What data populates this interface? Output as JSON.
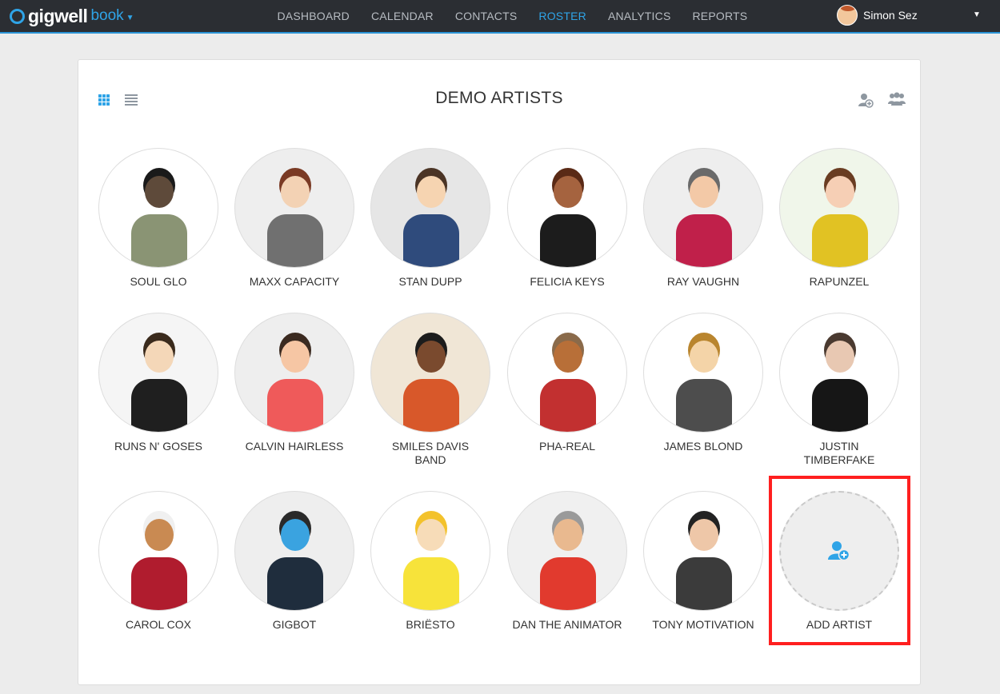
{
  "app": {
    "logo_text": "gigwell",
    "product": "book",
    "nav": [
      "DASHBOARD",
      "CALENDAR",
      "CONTACTS",
      "ROSTER",
      "ANALYTICS",
      "REPORTS"
    ],
    "active_nav": "ROSTER",
    "user_name": "Simon Sez"
  },
  "roster": {
    "title": "DEMO ARTISTS",
    "view_modes": [
      "grid-icon",
      "list-icon"
    ],
    "active_view": "grid",
    "header_actions": [
      "add-artist-icon",
      "add-band-icon"
    ],
    "artists": [
      {
        "name": "SOUL GLO",
        "skin": "#5e4a3a",
        "hair": "#1a1a1a",
        "shirt": "#8a9474",
        "bg": "#ffffff"
      },
      {
        "name": "MAXX CAPACITY",
        "skin": "#f3d2b4",
        "hair": "#7a3a24",
        "shirt": "#707070",
        "bg": "#eeeeee"
      },
      {
        "name": "STAN DUPP",
        "skin": "#f6d4b1",
        "hair": "#4b3425",
        "shirt": "#2f4b7c",
        "bg": "#e6e6e6"
      },
      {
        "name": "FELICIA KEYS",
        "skin": "#a5633f",
        "hair": "#5a2a16",
        "shirt": "#1c1c1c",
        "bg": "#ffffff"
      },
      {
        "name": "RAY VAUGHN",
        "skin": "#f3c9a7",
        "hair": "#6a6a6a",
        "shirt": "#c0204a",
        "bg": "#eeeeee"
      },
      {
        "name": "RAPUNZEL",
        "skin": "#f6cfb5",
        "hair": "#6a3d22",
        "shirt": "#e1c223",
        "bg": "#f0f6ea"
      },
      {
        "name": "RUNS N' GOSES",
        "skin": "#f4d7b8",
        "hair": "#3a2a1c",
        "shirt": "#1f1f1f",
        "bg": "#f5f5f5"
      },
      {
        "name": "CALVIN HAIRLESS",
        "skin": "#f6c6a4",
        "hair": "#3b2a20",
        "shirt": "#ef5a5a",
        "bg": "#eeeeee"
      },
      {
        "name": "SMILES DAVIS BAND",
        "skin": "#7a4a2e",
        "hair": "#1c1c1c",
        "shirt": "#d8582a",
        "bg": "#f0e6d6"
      },
      {
        "name": "PHA-REAL",
        "skin": "#b86f38",
        "hair": "#8a6a4a",
        "shirt": "#c23030",
        "bg": "#ffffff"
      },
      {
        "name": "JAMES BLOND",
        "skin": "#f4d4a8",
        "hair": "#b9852e",
        "shirt": "#4d4d4d",
        "bg": "#ffffff"
      },
      {
        "name": "JUSTIN TIMBERFAKE",
        "skin": "#e8c8b2",
        "hair": "#4a3a30",
        "shirt": "#161616",
        "bg": "#ffffff"
      },
      {
        "name": "CAROL COX",
        "skin": "#c98a52",
        "hair": "#f0f0f0",
        "shirt": "#b01c2e",
        "bg": "#ffffff"
      },
      {
        "name": "GIGBOT",
        "skin": "#3aa3e0",
        "hair": "#2a2a2a",
        "shirt": "#1f2d3d",
        "bg": "#eeeeee"
      },
      {
        "name": "BRIËSTO",
        "skin": "#f7dcb8",
        "hair": "#f3c22c",
        "shirt": "#f7e33a",
        "bg": "#ffffff"
      },
      {
        "name": "DAN THE ANIMATOR",
        "skin": "#e9b98f",
        "hair": "#9a9a9a",
        "shirt": "#e13a2e",
        "bg": "#f0f0f0"
      },
      {
        "name": "TONY MOTIVATION",
        "skin": "#eec7a8",
        "hair": "#222222",
        "shirt": "#3b3b3b",
        "bg": "#ffffff"
      }
    ],
    "add_artist_label": "ADD ARTIST"
  },
  "colors": {
    "accent": "#2fa4e7",
    "topbar": "#2b2e33",
    "highlight": "#ff1f1f"
  }
}
